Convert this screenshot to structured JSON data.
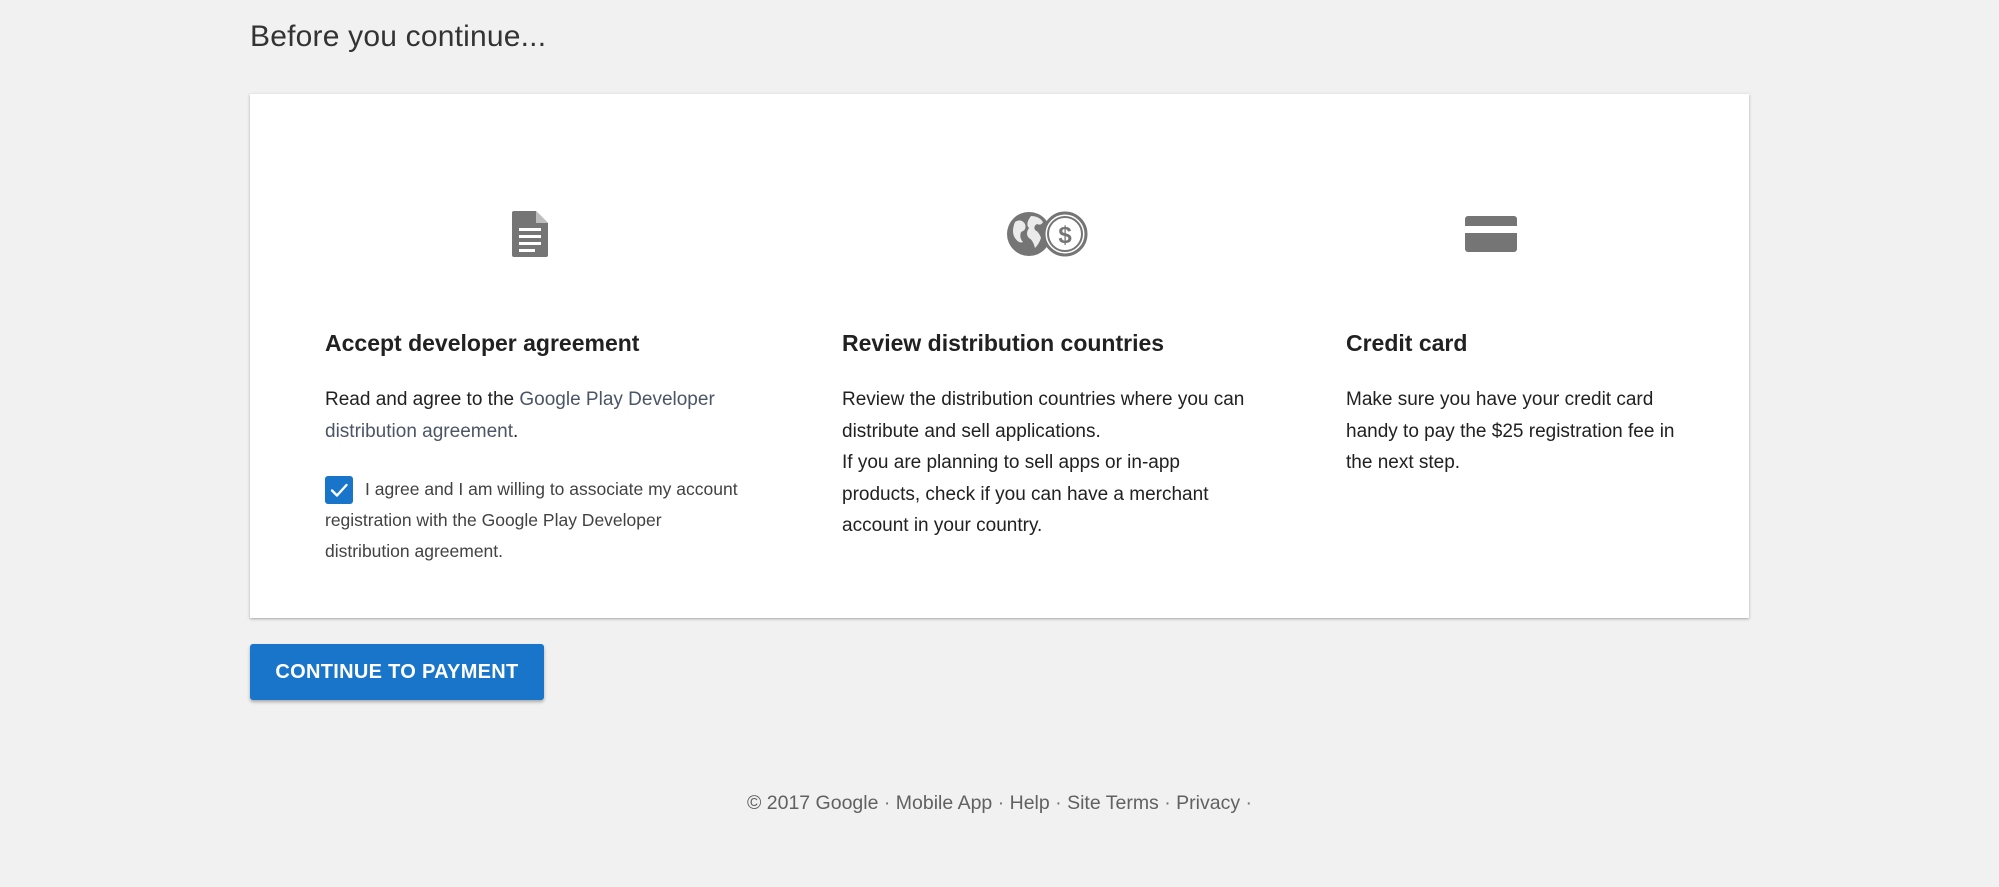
{
  "page": {
    "title": "Before you continue..."
  },
  "steps": [
    {
      "icon": "document-icon",
      "heading": "Accept developer agreement",
      "body_prefix": "Read and agree to the ",
      "body_link": "Google Play Developer distribution agreement",
      "body_suffix": ".",
      "checkbox_checked": true,
      "checkbox_label": "I agree and I am willing to associate my account registration with the Google Play Developer distribution agreement."
    },
    {
      "icon": "globe-dollar-icon",
      "heading": "Review distribution countries",
      "body_line1": "Review the distribution countries where you can distribute and sell applications.",
      "body_line2": "If you are planning to sell apps or in-app products, check if you can have a merchant account in your country."
    },
    {
      "icon": "credit-card-icon",
      "heading": "Credit card",
      "body": "Make sure you have your credit card handy to pay the $25 registration fee in the next step."
    }
  ],
  "actions": {
    "continue_label": "CONTINUE TO PAYMENT"
  },
  "footer": {
    "copyright": "© 2017 Google",
    "links": [
      "Mobile App",
      "Help",
      "Site Terms",
      "Privacy"
    ],
    "separator": "·"
  },
  "colors": {
    "accent": "#1875c9",
    "icon_gray": "#757575",
    "background": "#f1f1f1"
  }
}
